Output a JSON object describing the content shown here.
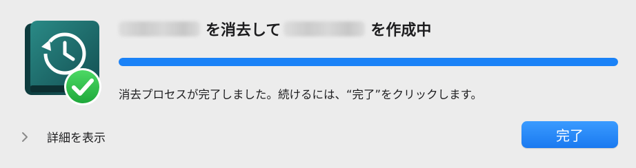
{
  "dialog": {
    "title_mid": "を消去して",
    "title_tail": "を作成中",
    "progress_value": 1.0,
    "message": "消去プロセスが完了しました。続けるには、“完了”をクリックします。",
    "show_details_label": "詳細を表示",
    "done_label": "完了"
  },
  "icons": {
    "drive": "time-machine-drive-icon",
    "badge": "checkmark-badge-icon",
    "disclosure": "chevron-right-icon"
  },
  "colors": {
    "accent": "#1a82f7",
    "success": "#28c840",
    "drive_body": "#1e6b6b"
  }
}
